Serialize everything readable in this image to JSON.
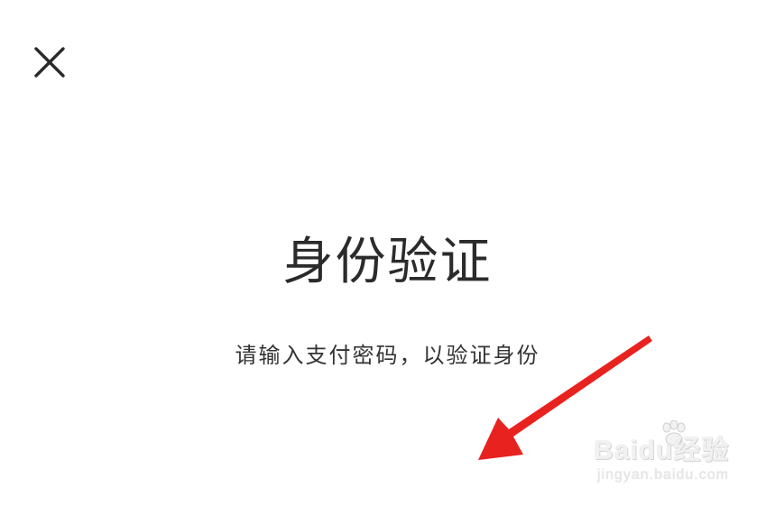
{
  "dialog": {
    "close_icon": "close-icon",
    "title": "身份验证",
    "subtitle": "请输入支付密码，以验证身份"
  },
  "overlay": {
    "arrow_color": "#e8231f",
    "watermark_logo": "Baidu经验",
    "watermark_url": "jingyan.baidu.com"
  }
}
